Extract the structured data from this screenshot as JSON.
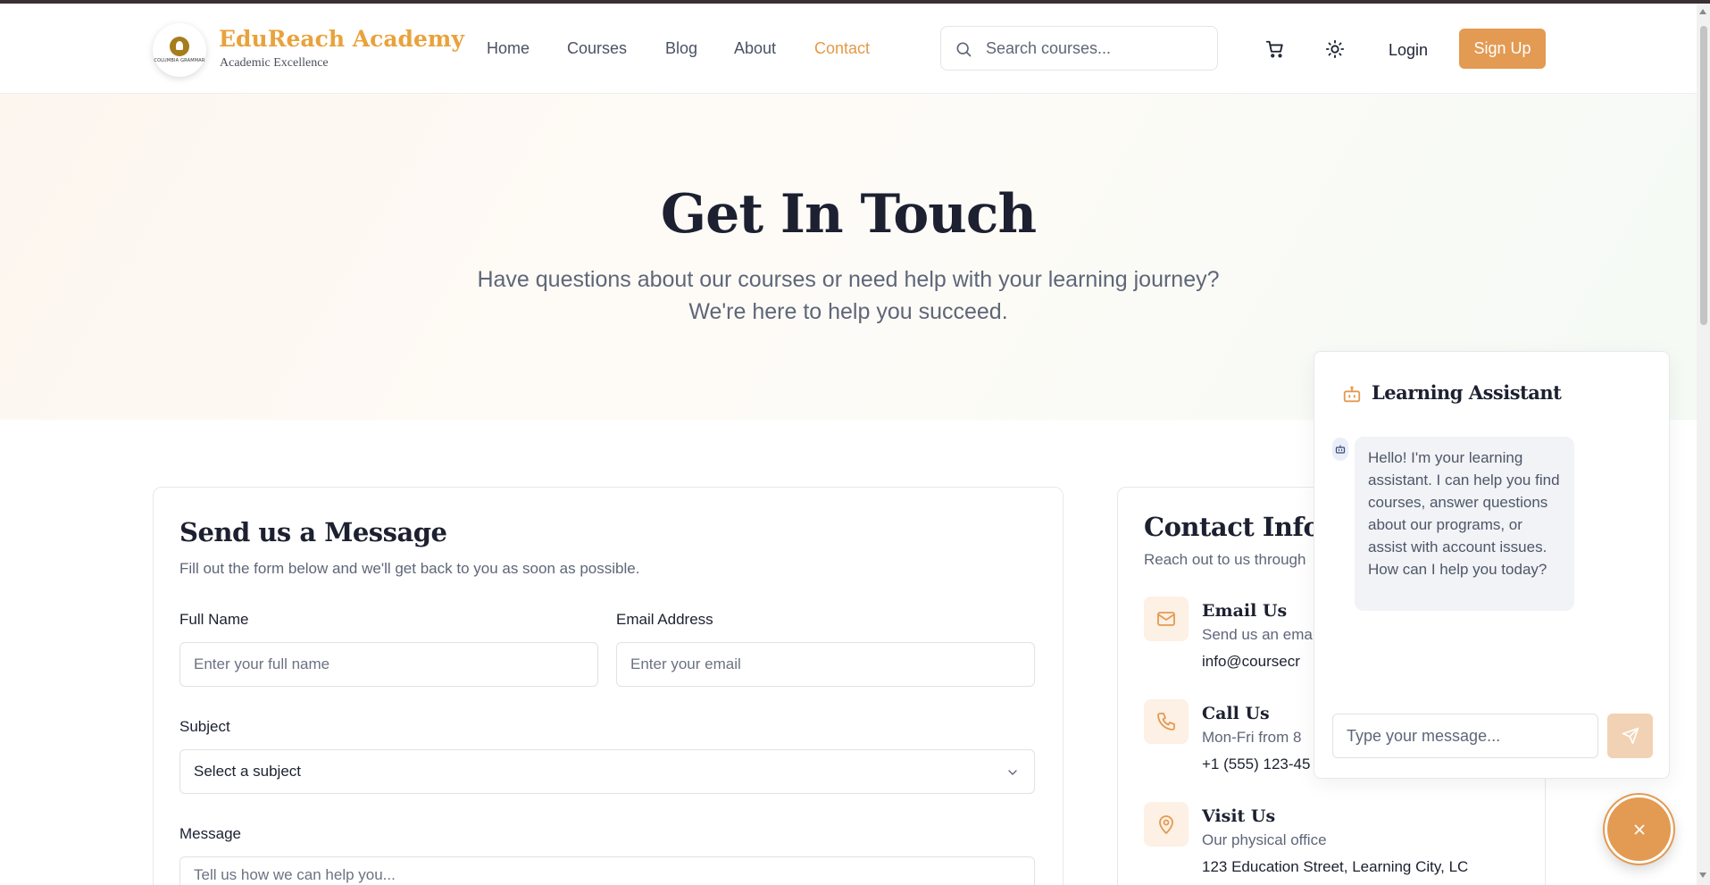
{
  "brand": {
    "name": "EduReach Academy",
    "tagline": "Academic Excellence",
    "logo_text": "COLUMBIA GRAMMAR"
  },
  "nav": {
    "items": [
      {
        "label": "Home",
        "active": false
      },
      {
        "label": "Courses",
        "active": false
      },
      {
        "label": "Blog",
        "active": false
      },
      {
        "label": "About",
        "active": false
      },
      {
        "label": "Contact",
        "active": true
      }
    ]
  },
  "search": {
    "placeholder": "Search courses...",
    "value": ""
  },
  "header_actions": {
    "login_label": "Login",
    "signup_label": "Sign Up"
  },
  "hero": {
    "title": "Get In Touch",
    "subtitle_line1": "Have questions about our courses or need help with your learning journey?",
    "subtitle_line2": "We're here to help you succeed."
  },
  "form": {
    "title": "Send us a Message",
    "description": "Fill out the form below and we'll get back to you as soon as possible.",
    "full_name": {
      "label": "Full Name",
      "placeholder": "Enter your full name"
    },
    "email": {
      "label": "Email Address",
      "placeholder": "Enter your email"
    },
    "subject": {
      "label": "Subject",
      "selected": "Select a subject"
    },
    "message": {
      "label": "Message",
      "placeholder": "Tell us how we can help you..."
    }
  },
  "contact_info": {
    "title": "Contact Inform",
    "description": "Reach out to us through",
    "items": [
      {
        "icon": "mail-icon",
        "title": "Email Us",
        "subtitle": "Send us an ema",
        "value": "info@coursecr"
      },
      {
        "icon": "phone-icon",
        "title": "Call Us",
        "subtitle": "Mon-Fri from 8",
        "value": "+1 (555) 123-45"
      },
      {
        "icon": "map-pin-icon",
        "title": "Visit Us",
        "subtitle": "Our physical office",
        "value": "123 Education Street, Learning City, LC"
      }
    ]
  },
  "chat": {
    "title": "Learning Assistant",
    "bot_message": "Hello! I'm your learning assistant. I can help you find courses, answer questions about our programs, or assist with account issues. How can I help you today?",
    "input_placeholder": "Type your message..."
  },
  "colors": {
    "accent": "#e39a52",
    "brand_gold": "#e9a23b",
    "heading": "#1c2030",
    "muted": "#5e6678"
  }
}
